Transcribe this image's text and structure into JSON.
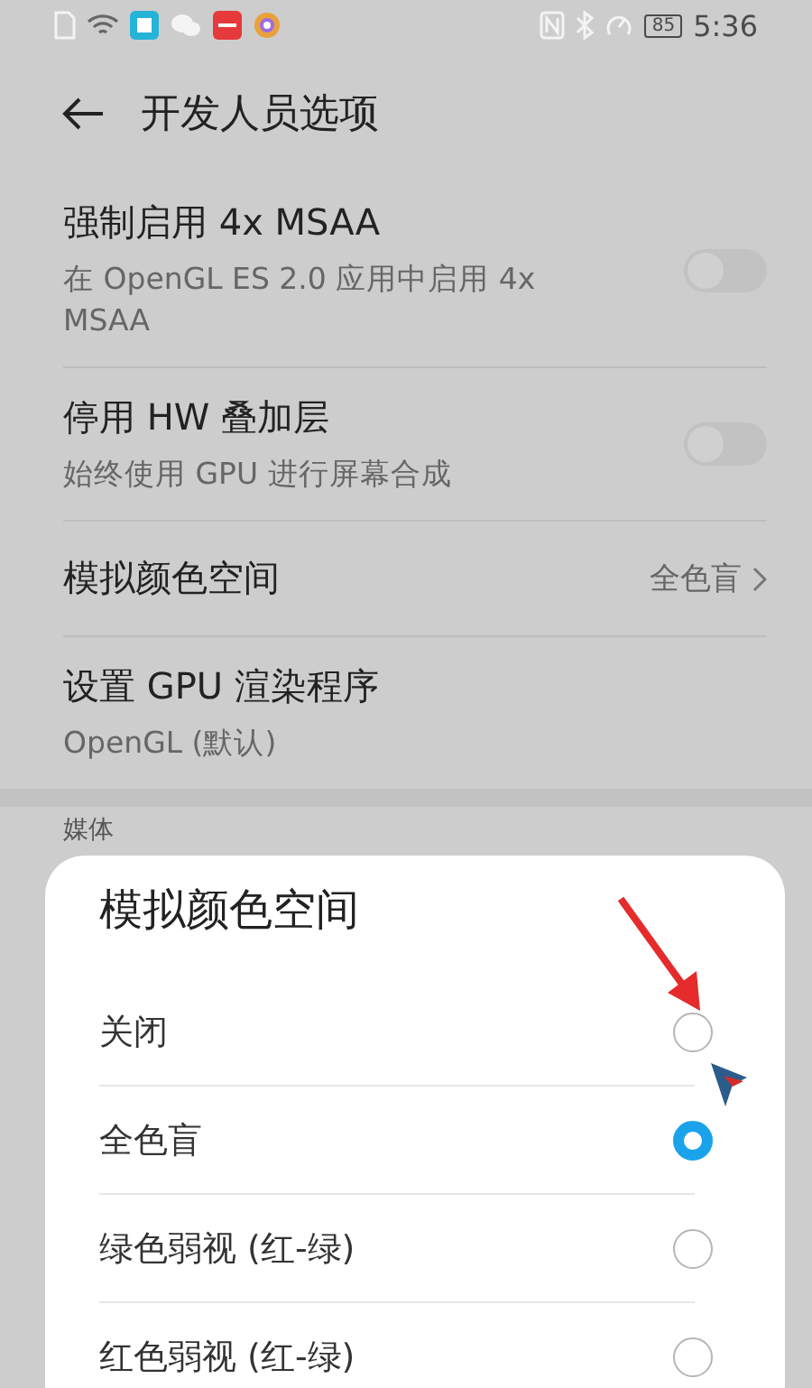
{
  "status_bar": {
    "battery": "85",
    "time": "5:36"
  },
  "header": {
    "title": "开发人员选项"
  },
  "settings": [
    {
      "kind": "toggle",
      "title": "强制启用 4x MSAA",
      "subtitle": "在 OpenGL ES 2.0 应用中启用 4x MSAA",
      "on": false
    },
    {
      "kind": "toggle",
      "title": "停用 HW 叠加层",
      "subtitle": "始终使用 GPU 进行屏幕合成",
      "on": false
    },
    {
      "kind": "value",
      "title": "模拟颜色空间",
      "value": "全色盲"
    },
    {
      "kind": "text",
      "title": "设置 GPU 渲染程序",
      "subtitle": "OpenGL (默认)"
    }
  ],
  "section_header": "媒体",
  "dialog": {
    "title": "模拟颜色空间",
    "options": [
      {
        "label": "关闭",
        "selected": false
      },
      {
        "label": "全色盲",
        "selected": true
      },
      {
        "label": "绿色弱视 (红-绿)",
        "selected": false
      },
      {
        "label": "红色弱视 (红-绿)",
        "selected": false
      }
    ]
  }
}
